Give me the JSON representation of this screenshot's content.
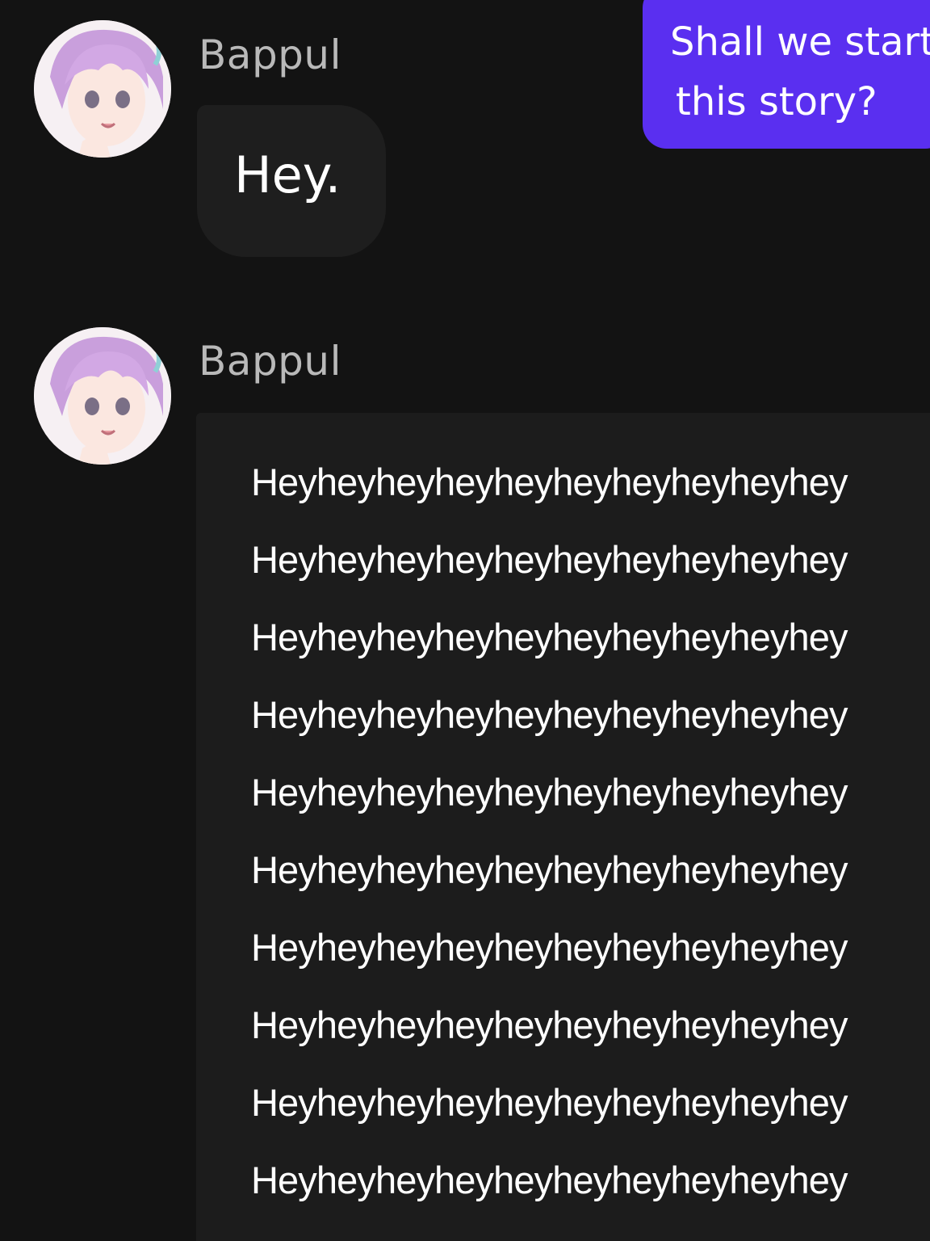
{
  "chat": {
    "messages": [
      {
        "sender": "Bappul",
        "text": "Hey."
      },
      {
        "sender": "Bappul",
        "lines": [
          "Heyheyheyheyheyheyheyheyheyhey",
          "Heyheyheyheyheyheyheyheyheyhey",
          "Heyheyheyheyheyheyheyheyheyhey",
          "Heyheyheyheyheyheyheyheyheyhey",
          "Heyheyheyheyheyheyheyheyheyhey",
          "Heyheyheyheyheyheyheyheyheyhey",
          "Heyheyheyheyheyheyheyheyheyhey",
          "Heyheyheyheyheyheyheyheyheyhey",
          "Heyheyheyheyheyheyheyheyheyhey",
          "Heyheyheyheyheyheyheyheyheyhey"
        ]
      }
    ],
    "user_message": {
      "line1": "Shall we start",
      "line2": "this story?"
    }
  },
  "colors": {
    "background": "#131313",
    "bot_bubble": "#1e1e1e",
    "user_bubble": "#5a2ff0",
    "sender_name": "#b9b9b9",
    "message_text": "#ffffff"
  },
  "icons": {
    "avatar": "character-avatar-purple-hair"
  }
}
